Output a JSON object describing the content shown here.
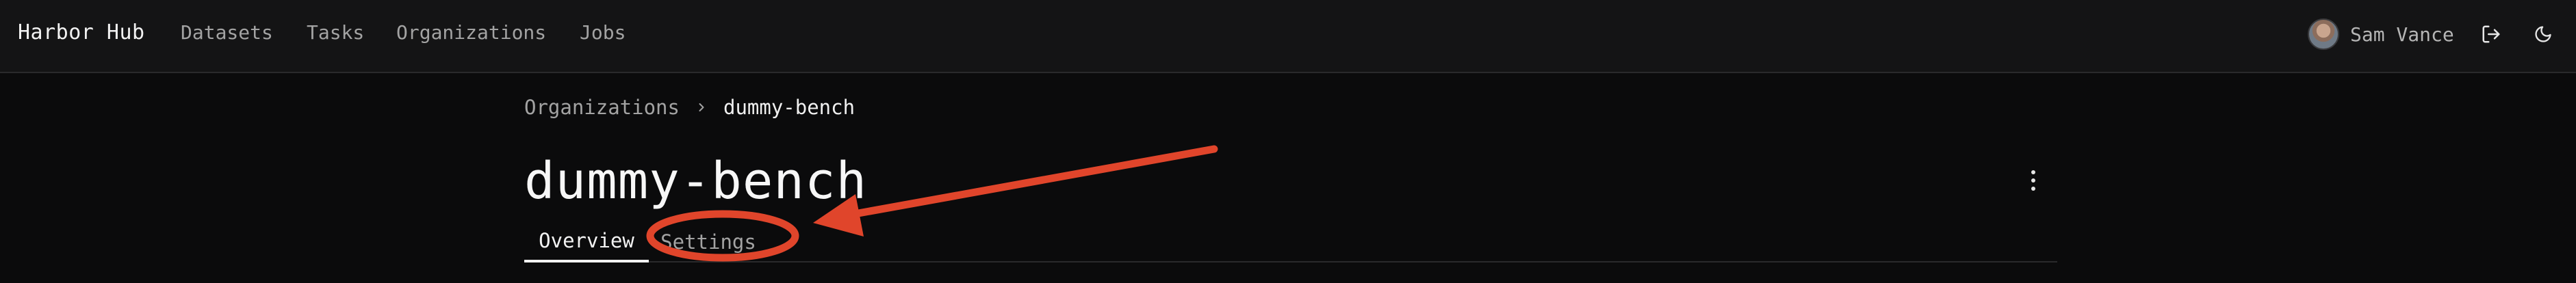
{
  "app": {
    "brand": "Harbor Hub"
  },
  "nav": {
    "items": [
      {
        "label": "Datasets"
      },
      {
        "label": "Tasks"
      },
      {
        "label": "Organizations"
      },
      {
        "label": "Jobs"
      }
    ]
  },
  "user": {
    "name": "Sam Vance"
  },
  "icons": {
    "logout": "logout-icon",
    "theme": "moon-icon",
    "more": "kebab-menu-icon",
    "separator": "chevron-right-icon"
  },
  "breadcrumb": {
    "parent": "Organizations",
    "current": "dummy-bench"
  },
  "page": {
    "title": "dummy-bench"
  },
  "tabs": [
    {
      "label": "Overview",
      "active": true
    },
    {
      "label": "Settings",
      "active": false
    }
  ],
  "colors": {
    "background": "#0b0b0c",
    "navbar": "#141415",
    "annotation": "#e0452b"
  }
}
